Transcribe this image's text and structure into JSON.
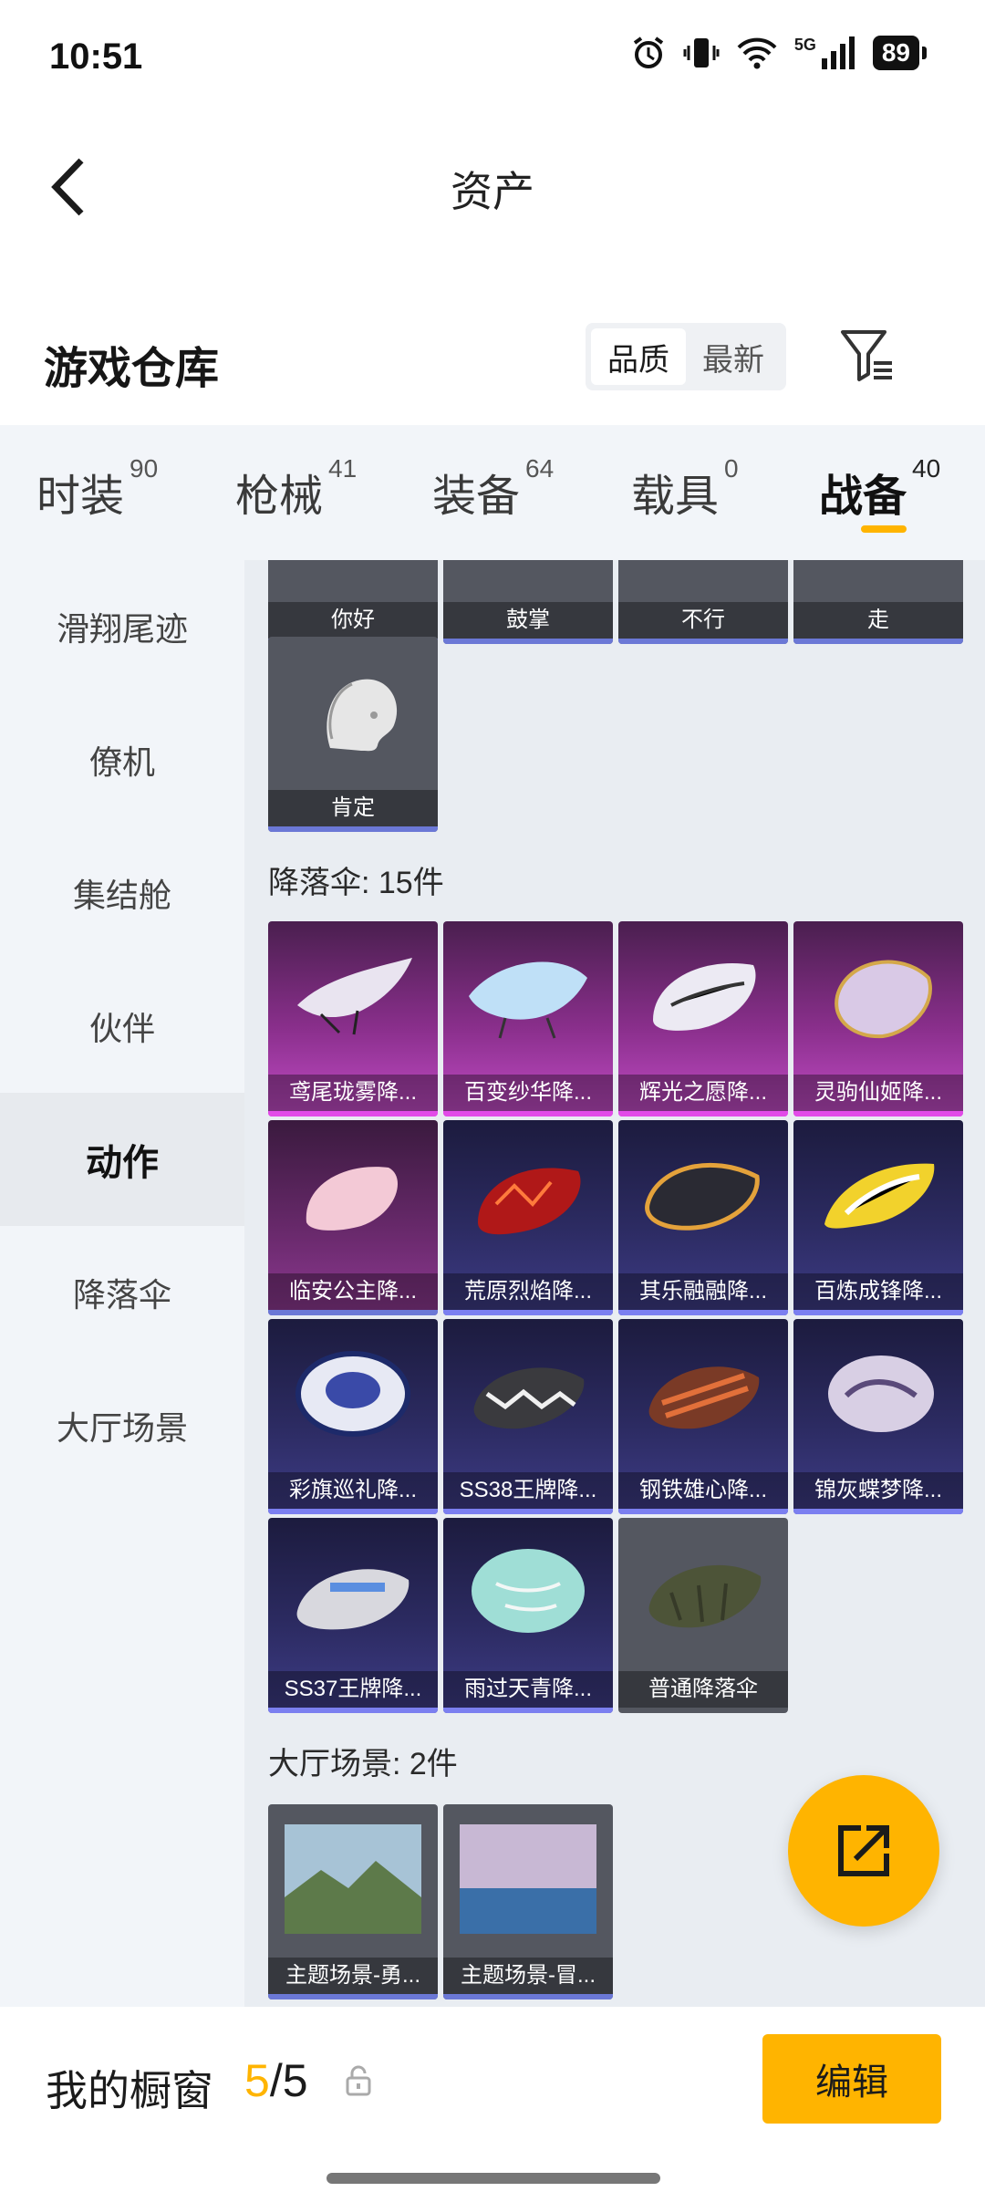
{
  "status_bar": {
    "time": "10:51",
    "battery": "89",
    "network": "5G"
  },
  "header": {
    "title": "资产"
  },
  "warehouse": {
    "title": "游戏仓库",
    "sort_options": [
      "品质",
      "最新"
    ]
  },
  "category_tabs": [
    {
      "label": "时装",
      "count": "90"
    },
    {
      "label": "枪械",
      "count": "41"
    },
    {
      "label": "装备",
      "count": "64"
    },
    {
      "label": "载具",
      "count": "0"
    },
    {
      "label": "战备",
      "count": "40"
    }
  ],
  "sidebar": {
    "items": [
      "滑翔尾迹",
      "僚机",
      "集结舱",
      "伙伴",
      "动作",
      "降落伞",
      "大厅场景"
    ]
  },
  "actions": {
    "items": [
      "你好",
      "鼓掌",
      "不行",
      "走",
      "肯定"
    ]
  },
  "parachutes": {
    "title": "降落伞: 15件",
    "items": [
      "鸢尾珑雾降...",
      "百变纱华降...",
      "辉光之愿降...",
      "灵驹仙姬降...",
      "临安公主降...",
      "荒原烈焰降...",
      "其乐融融降...",
      "百炼成锋降...",
      "彩旗巡礼降...",
      "SS38王牌降...",
      "钢铁雄心降...",
      "锦灰蝶梦降...",
      "SS37王牌降...",
      "雨过天青降...",
      "普通降落伞"
    ]
  },
  "lobby_scenes": {
    "title": "大厅场景: 2件",
    "items": [
      "主题场景-勇...",
      "主题场景-冒..."
    ]
  },
  "showcase": {
    "label": "我的橱窗",
    "current": "5",
    "separator": "/",
    "total": "5",
    "edit_label": "编辑"
  },
  "colors": {
    "accent": "#ffb400",
    "sidebar_bg": "#f2f5f9",
    "content_bg": "#e9edf2"
  }
}
